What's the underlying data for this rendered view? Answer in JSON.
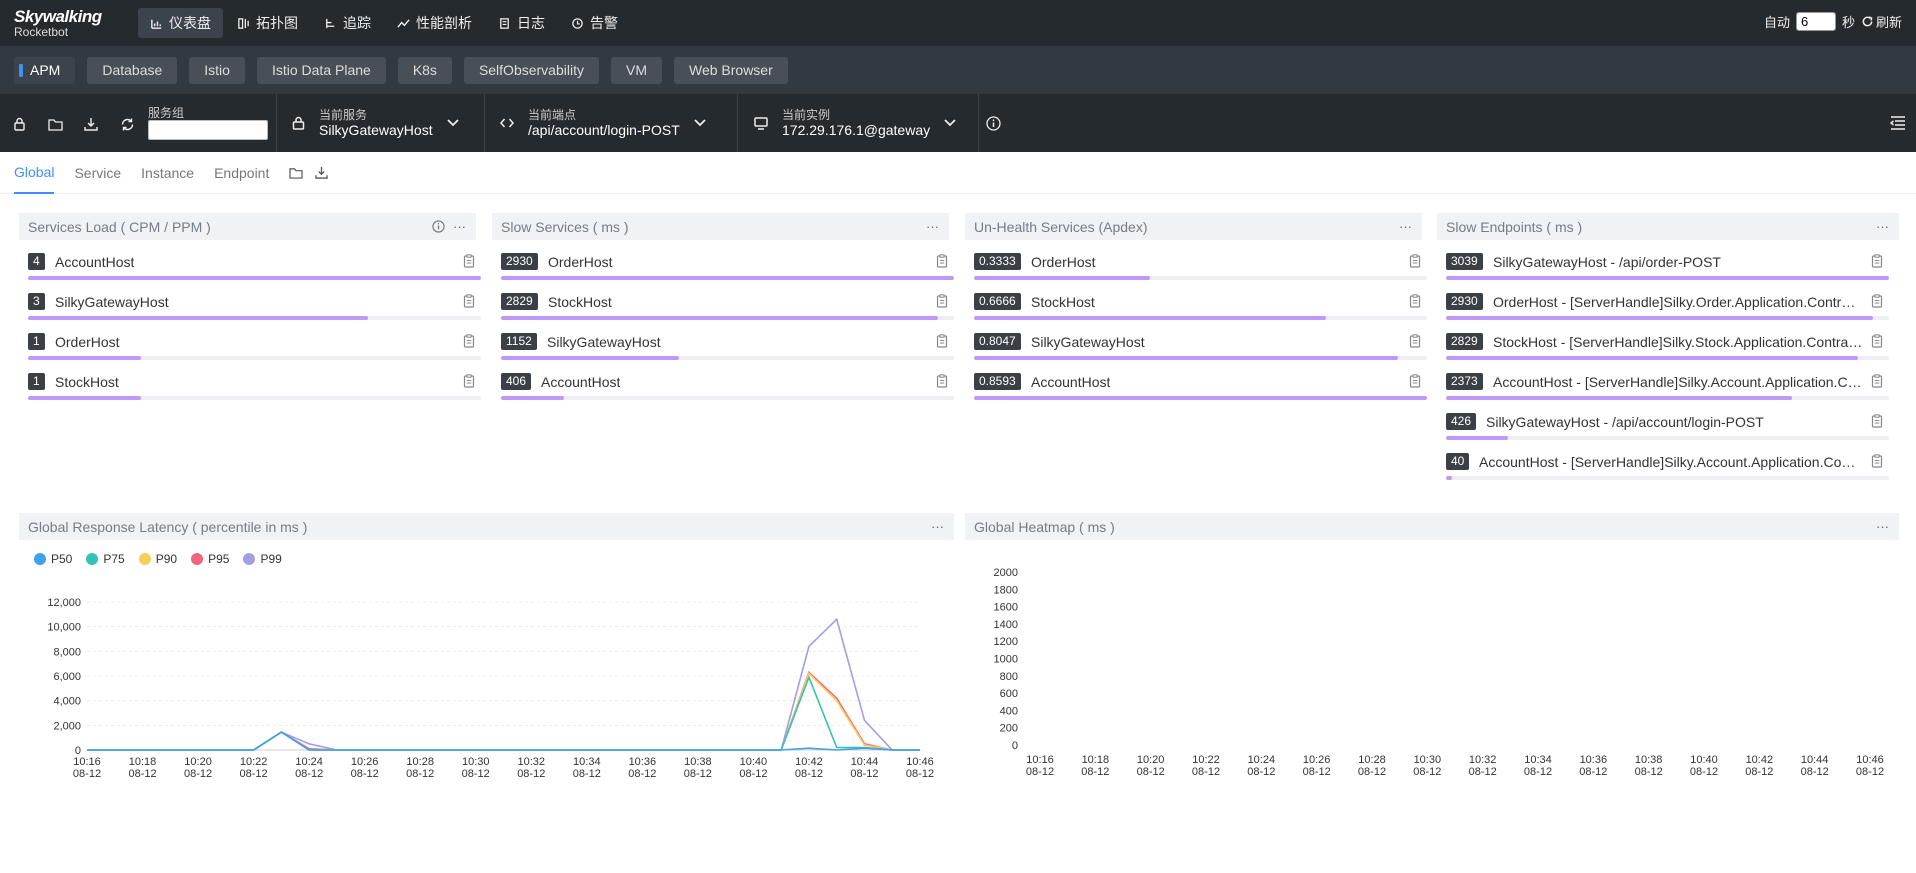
{
  "brand": {
    "title": "Skywalking",
    "subtitle": "Rocketbot"
  },
  "nav": [
    {
      "label": "仪表盘",
      "icon": "dashboard-icon",
      "active": true
    },
    {
      "label": "拓扑图",
      "icon": "topology-icon",
      "active": false
    },
    {
      "label": "追踪",
      "icon": "trace-icon",
      "active": false
    },
    {
      "label": "性能剖析",
      "icon": "profile-icon",
      "active": false
    },
    {
      "label": "日志",
      "icon": "log-icon",
      "active": false
    },
    {
      "label": "告警",
      "icon": "alarm-icon",
      "active": false
    }
  ],
  "auto_refresh": {
    "auto_label": "自动",
    "interval": "6",
    "unit": "秒",
    "refresh_label": "刷新"
  },
  "layers": [
    "APM",
    "Database",
    "Istio",
    "Istio Data Plane",
    "K8s",
    "SelfObservability",
    "VM",
    "Web Browser"
  ],
  "selectors": {
    "group_label": "服务组",
    "service_label": "当前服务",
    "service_value": "SilkyGatewayHost",
    "endpoint_label": "当前端点",
    "endpoint_value": "/api/account/login-POST",
    "instance_label": "当前实例",
    "instance_value": "172.29.176.1@gateway"
  },
  "subtabs": [
    "Global",
    "Service",
    "Instance",
    "Endpoint"
  ],
  "panels": {
    "services_load": {
      "title": "Services Load ( CPM / PPM )",
      "rows": [
        {
          "value": "4",
          "name": "AccountHost",
          "ratio": 1.0
        },
        {
          "value": "3",
          "name": "SilkyGatewayHost",
          "ratio": 0.75
        },
        {
          "value": "1",
          "name": "OrderHost",
          "ratio": 0.25
        },
        {
          "value": "1",
          "name": "StockHost",
          "ratio": 0.25
        }
      ]
    },
    "slow_services": {
      "title": "Slow Services ( ms )",
      "rows": [
        {
          "value": "2930",
          "name": "OrderHost",
          "ratio": 1.0
        },
        {
          "value": "2829",
          "name": "StockHost",
          "ratio": 0.965
        },
        {
          "value": "1152",
          "name": "SilkyGatewayHost",
          "ratio": 0.393
        },
        {
          "value": "406",
          "name": "AccountHost",
          "ratio": 0.139
        }
      ]
    },
    "unhealth_services": {
      "title": "Un-Health Services (Apdex)",
      "rows": [
        {
          "value": "0.3333",
          "name": "OrderHost",
          "ratio": 0.388
        },
        {
          "value": "0.6666",
          "name": "StockHost",
          "ratio": 0.776
        },
        {
          "value": "0.8047",
          "name": "SilkyGatewayHost",
          "ratio": 0.937
        },
        {
          "value": "0.8593",
          "name": "AccountHost",
          "ratio": 1.0
        }
      ]
    },
    "slow_endpoints": {
      "title": "Slow Endpoints ( ms )",
      "rows": [
        {
          "value": "3039",
          "name": "SilkyGatewayHost - /api/order-POST",
          "ratio": 1.0
        },
        {
          "value": "2930",
          "name": "OrderHost - [ServerHandle]Silky.Order.Application.Contrac...",
          "ratio": 0.964
        },
        {
          "value": "2829",
          "name": "StockHost - [ServerHandle]Silky.Stock.Application.Contract...",
          "ratio": 0.931
        },
        {
          "value": "2373",
          "name": "AccountHost - [ServerHandle]Silky.Account.Application.Co...",
          "ratio": 0.781
        },
        {
          "value": "426",
          "name": "SilkyGatewayHost - /api/account/login-POST",
          "ratio": 0.14
        },
        {
          "value": "40",
          "name": "AccountHost - [ServerHandle]Silky.Account.Application.Contr...",
          "ratio": 0.013
        }
      ]
    },
    "latency": {
      "title": "Global Response Latency ( percentile in ms )"
    },
    "heatmap": {
      "title": "Global Heatmap ( ms )"
    }
  },
  "chart_data": [
    {
      "type": "line",
      "title": "Global Response Latency ( percentile in ms )",
      "x": [
        "10:16",
        "10:17",
        "10:18",
        "10:19",
        "10:20",
        "10:21",
        "10:22",
        "10:23",
        "10:24",
        "10:25",
        "10:26",
        "10:27",
        "10:28",
        "10:29",
        "10:30",
        "10:31",
        "10:32",
        "10:33",
        "10:34",
        "10:35",
        "10:36",
        "10:37",
        "10:38",
        "10:39",
        "10:40",
        "10:41",
        "10:42",
        "10:43",
        "10:44",
        "10:45",
        "10:46"
      ],
      "x_ticks": [
        "10:16",
        "10:18",
        "10:20",
        "10:22",
        "10:24",
        "10:26",
        "10:28",
        "10:30",
        "10:32",
        "10:34",
        "10:36",
        "10:38",
        "10:40",
        "10:42",
        "10:44",
        "10:46"
      ],
      "x_date": "08-12",
      "ylim": [
        0,
        12000
      ],
      "y_ticks": [
        "0",
        "2,000",
        "4,000",
        "6,000",
        "8,000",
        "10,000",
        "12,000"
      ],
      "series": [
        {
          "name": "P50",
          "color": "#3fa2e9",
          "values": [
            0,
            0,
            0,
            0,
            0,
            0,
            0,
            1450,
            0,
            0,
            0,
            0,
            0,
            0,
            0,
            0,
            0,
            0,
            0,
            0,
            0,
            0,
            0,
            0,
            0,
            0,
            150,
            0,
            150,
            0,
            0
          ]
        },
        {
          "name": "P75",
          "color": "#36c1b7",
          "values": [
            0,
            0,
            0,
            0,
            0,
            0,
            0,
            1450,
            0,
            0,
            0,
            0,
            0,
            0,
            0,
            0,
            0,
            0,
            0,
            0,
            0,
            0,
            0,
            0,
            0,
            0,
            5900,
            200,
            200,
            0,
            0
          ]
        },
        {
          "name": "P90",
          "color": "#f9cd59",
          "values": [
            0,
            0,
            0,
            0,
            0,
            0,
            0,
            1450,
            0,
            0,
            0,
            0,
            0,
            0,
            0,
            0,
            0,
            0,
            0,
            0,
            0,
            0,
            0,
            0,
            0,
            0,
            6200,
            4000,
            400,
            0,
            0
          ]
        },
        {
          "name": "P95",
          "color": "#f1657e",
          "values": [
            0,
            0,
            0,
            0,
            0,
            0,
            0,
            1450,
            100,
            0,
            0,
            0,
            0,
            0,
            0,
            0,
            0,
            0,
            0,
            0,
            0,
            0,
            0,
            0,
            0,
            0,
            6300,
            4200,
            500,
            0,
            0
          ]
        },
        {
          "name": "P99",
          "color": "#a19ee4",
          "values": [
            0,
            0,
            0,
            0,
            0,
            0,
            0,
            1450,
            500,
            0,
            0,
            0,
            0,
            0,
            0,
            0,
            0,
            0,
            0,
            0,
            0,
            0,
            0,
            0,
            0,
            0,
            8400,
            10600,
            2400,
            0,
            0
          ]
        }
      ]
    },
    {
      "type": "heatmap",
      "title": "Global Heatmap ( ms )",
      "x_ticks": [
        "10:16",
        "10:18",
        "10:20",
        "10:22",
        "10:24",
        "10:26",
        "10:28",
        "10:30",
        "10:32",
        "10:34",
        "10:36",
        "10:38",
        "10:40",
        "10:42",
        "10:44",
        "10:46"
      ],
      "x_date": "08-12",
      "y_ticks": [
        "0",
        "200",
        "400",
        "600",
        "800",
        "1000",
        "1200",
        "1400",
        "1600",
        "1800",
        "2000"
      ],
      "values": []
    }
  ]
}
